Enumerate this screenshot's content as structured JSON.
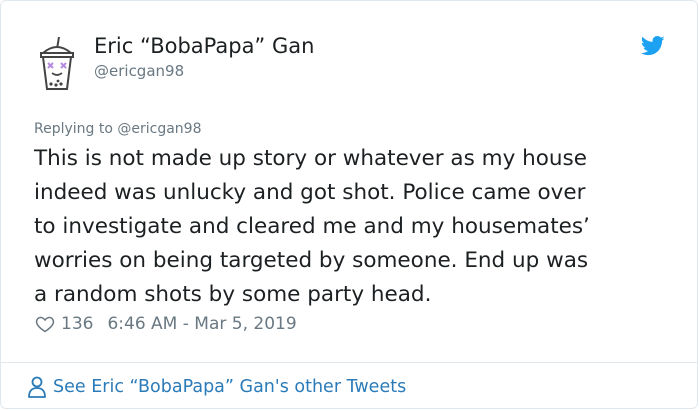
{
  "author": {
    "display_name": "Eric “BobaPapa” Gan",
    "handle": "@ericgan98"
  },
  "reply": {
    "text": "Replying to @ericgan98"
  },
  "tweet": {
    "lines": [
      "This is not made up story or whatever as my house",
      "indeed was unlucky and got shot. Police came over",
      "to investigate and cleared me and my housemates’",
      "worries on being targeted by someone. End up was",
      "a random shots by some party head."
    ],
    "likes": "136",
    "timestamp": "6:46 AM - Mar 5, 2019"
  },
  "footer": {
    "link_text": "See Eric “BobaPapa” Gan's other Tweets"
  },
  "icons": {
    "avatar": "boba-cup-avatar",
    "brand": "twitter-bird-icon",
    "like": "heart-icon",
    "profile": "person-icon"
  },
  "colors": {
    "link": "#2b7bb9",
    "brand": "#1da1f2",
    "muted": "#697882",
    "text": "#1c2022"
  }
}
